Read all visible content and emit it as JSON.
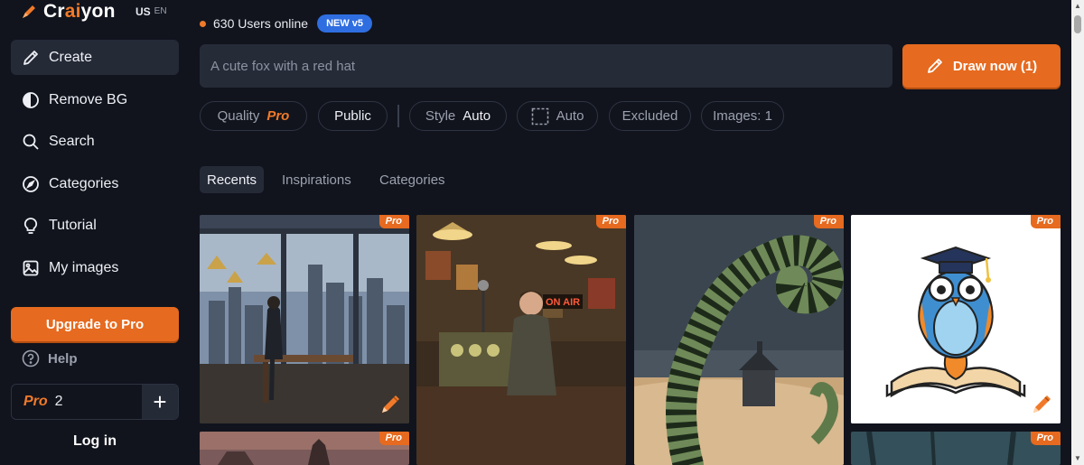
{
  "brand": {
    "name_prefix": "Cr",
    "name_ai": "ai",
    "name_suffix": "yon",
    "locale": "US",
    "locale_alt": "EN"
  },
  "sidebar": {
    "items": [
      {
        "label": "Create",
        "icon": "pencil-icon",
        "active": true
      },
      {
        "label": "Remove BG",
        "icon": "contrast-icon"
      },
      {
        "label": "Search",
        "icon": "search-icon"
      },
      {
        "label": "Categories",
        "icon": "compass-icon"
      },
      {
        "label": "Tutorial",
        "icon": "lightbulb-icon"
      },
      {
        "label": "My images",
        "icon": "image-icon"
      }
    ],
    "upgrade_label": "Upgrade to Pro",
    "help_label": "Help",
    "pro_label": "Pro",
    "pro_count": "2",
    "plus_label": "+",
    "login_label": "Log in"
  },
  "status": {
    "users_online": "630 Users online",
    "badge": "NEW v5"
  },
  "prompt": {
    "placeholder": "A cute fox with a red hat"
  },
  "draw_button": {
    "label": "Draw now (1)"
  },
  "options": {
    "quality_label": "Quality",
    "quality_value": "Pro",
    "visibility": "Public",
    "style_label": "Style",
    "style_value": "Auto",
    "ratio_value": "Auto",
    "excluded": "Excluded",
    "images": "Images: 1"
  },
  "tabs": [
    "Recents",
    "Inspirations",
    "Categories"
  ],
  "gallery": {
    "pro_tag": "Pro",
    "on_air": "ON AIR"
  },
  "colors": {
    "accent": "#e66a1f",
    "background": "#11141d",
    "panel": "#262b38",
    "badge": "#2f6ee0"
  }
}
